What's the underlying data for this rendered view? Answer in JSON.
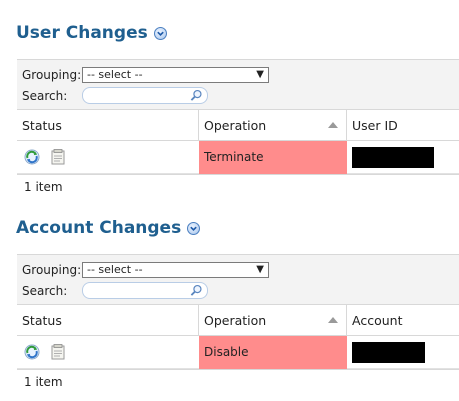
{
  "sections": [
    {
      "title": "User Changes",
      "grouping_label": "Grouping:",
      "grouping_value": "-- select --",
      "search_label": "Search:",
      "columns": {
        "status": "Status",
        "operation": "Operation",
        "third": "User ID"
      },
      "rows": [
        {
          "operation": "Terminate"
        }
      ],
      "count_text": "1 item"
    },
    {
      "title": "Account Changes",
      "grouping_label": "Grouping:",
      "grouping_value": "-- select --",
      "search_label": "Search:",
      "columns": {
        "status": "Status",
        "operation": "Operation",
        "third": "Account"
      },
      "rows": [
        {
          "operation": "Disable"
        }
      ],
      "count_text": "1 item"
    }
  ],
  "colors": {
    "title": "#1f5f8f",
    "operation_highlight": "#ff8c8c"
  },
  "icons": [
    "chevron-down-circle-icon",
    "search-icon",
    "refresh-icon",
    "notes-icon",
    "sort-ascending-icon"
  ]
}
